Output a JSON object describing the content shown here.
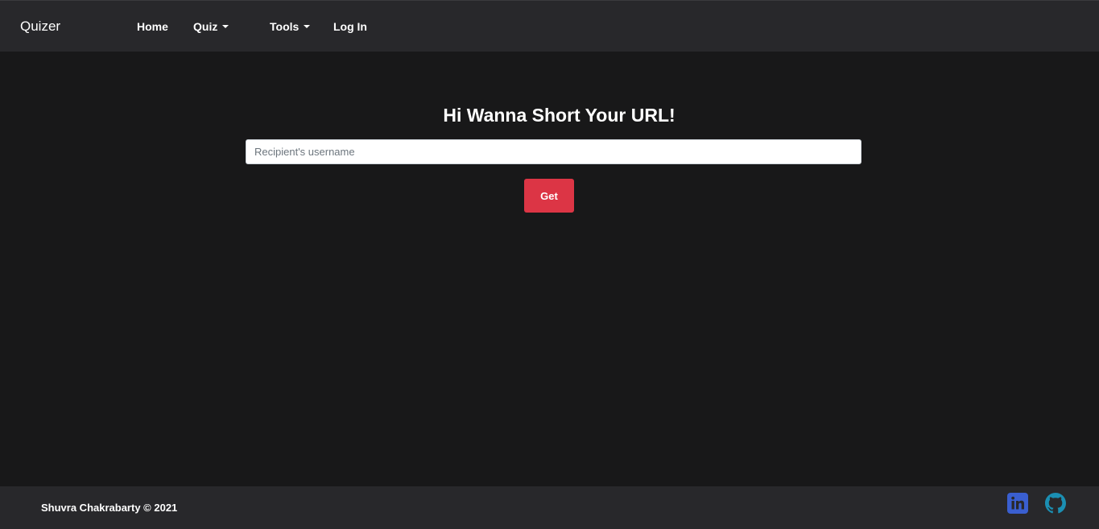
{
  "navbar": {
    "brand": "Quizer",
    "items": [
      {
        "label": "Home",
        "dropdown": false
      },
      {
        "label": "Quiz",
        "dropdown": true
      },
      {
        "label": "Tools",
        "dropdown": true
      },
      {
        "label": "Log In",
        "dropdown": false
      }
    ]
  },
  "main": {
    "heading": "Hi Wanna Short Your URL!",
    "input": {
      "placeholder": "Recipient's username",
      "value": ""
    },
    "button_label": "Get"
  },
  "footer": {
    "copyright": "Shuvra Chakrabarty © 2021",
    "social": [
      {
        "icon": "linkedin-icon",
        "color": "#3a5fd0"
      },
      {
        "icon": "github-icon",
        "color": "#1b8fb3"
      }
    ]
  },
  "colors": {
    "background": "#181819",
    "navbar": "#28282b",
    "accent_button": "#dc3545",
    "text": "#ffffff"
  }
}
